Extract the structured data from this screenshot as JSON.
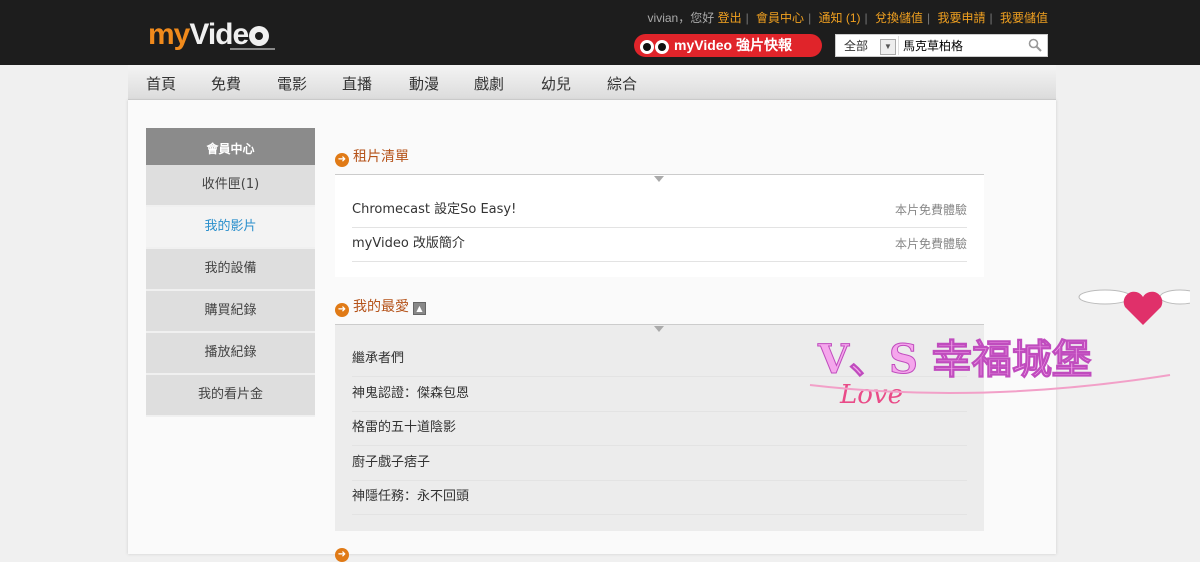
{
  "header": {
    "logo_my": "my",
    "logo_video": "Vide",
    "user": {
      "greeting": "vivian，您好",
      "links": [
        "登出",
        "會員中心",
        "通知 (1)",
        "兌換儲值",
        "我要申請",
        "我要儲值"
      ]
    },
    "promo": "myVideo 強片快報",
    "search": {
      "category": "全部",
      "query": "馬克草柏格"
    }
  },
  "nav": [
    "首頁",
    "免費",
    "電影",
    "直播",
    "動漫",
    "戲劇",
    "幼兒",
    "綜合"
  ],
  "sidebar": {
    "title": "會員中心",
    "items": [
      "收件匣(1)",
      "我的影片",
      "我的設備",
      "購買紀錄",
      "播放紀錄",
      "我的看片金"
    ],
    "active_index": 1
  },
  "rentals": {
    "title": "租片清單",
    "items": [
      {
        "name": "Chromecast 設定So Easy!",
        "status": "本片免費體驗"
      },
      {
        "name": "myVideo 改版簡介",
        "status": "本片免費體驗"
      }
    ]
  },
  "favorites": {
    "title": "我的最愛",
    "items": [
      "繼承者們",
      "神鬼認證：傑森包恩",
      "格雷的五十道陰影",
      "廚子戲子痞子",
      "神隱任務：永不回頭"
    ]
  },
  "watermark": {
    "text": "V、S 幸福城堡",
    "script": "Love"
  },
  "colors": {
    "accent": "#f08a1c",
    "link": "#f0a020",
    "active": "#2a8fcc",
    "section": "#b5531a",
    "promo": "#e0242a"
  }
}
